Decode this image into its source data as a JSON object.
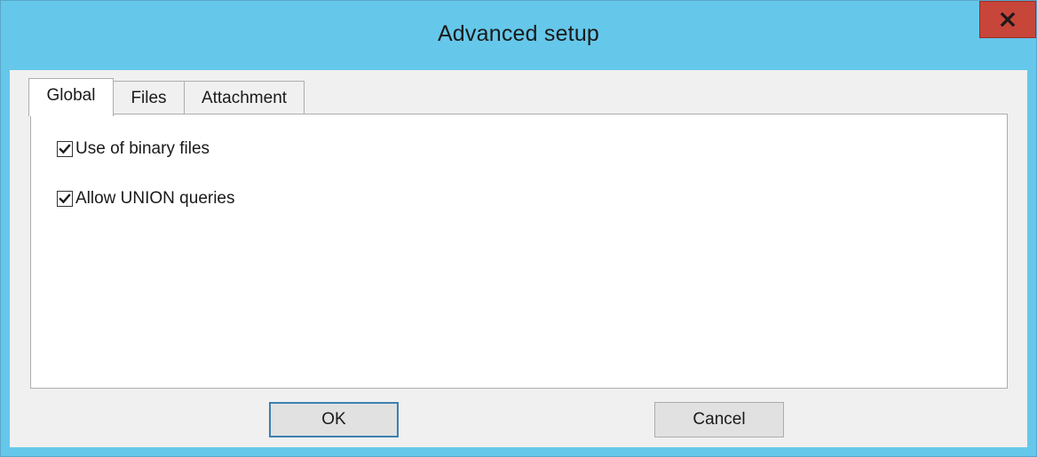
{
  "window": {
    "title": "Advanced setup",
    "close_icon": "close-icon"
  },
  "tabs": [
    {
      "label": "Global",
      "active": true
    },
    {
      "label": "Files",
      "active": false
    },
    {
      "label": "Attachment",
      "active": false
    }
  ],
  "global_tab": {
    "options": [
      {
        "label": "Use of binary files",
        "checked": true
      },
      {
        "label": "Allow UNION queries",
        "checked": true
      }
    ]
  },
  "buttons": {
    "ok_label": "OK",
    "cancel_label": "Cancel"
  },
  "colors": {
    "titlebar": "#65c8ea",
    "close_button": "#c8453a",
    "default_button_border": "#3c7fb1"
  }
}
